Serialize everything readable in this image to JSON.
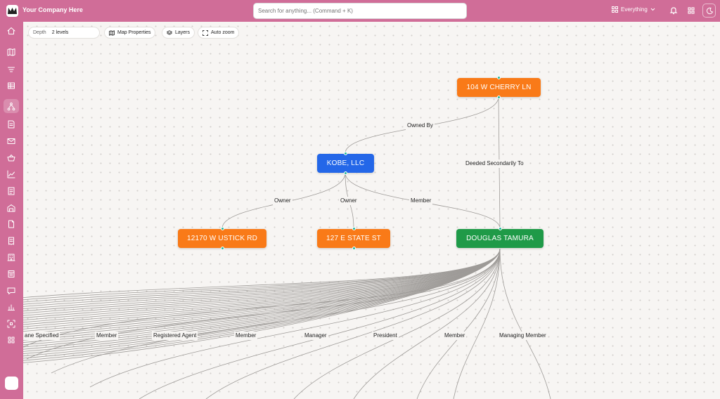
{
  "app": {
    "company_name": "Your Company Here",
    "search_placeholder": "Search for anything... (Command + K)",
    "scope_label": "Everything"
  },
  "toolbar": {
    "depth_label": "Depth",
    "depth_value": "2 levels",
    "map_properties_label": "Map Properties",
    "layers_label": "Layers",
    "auto_zoom_label": "Auto zoom"
  },
  "sidebar": {
    "items": [
      {
        "icon": "home-icon"
      },
      {
        "icon": "map-icon"
      },
      {
        "icon": "filter-icon"
      },
      {
        "icon": "table-icon"
      },
      {
        "icon": "graph-icon",
        "active": true
      },
      {
        "icon": "document-icon"
      },
      {
        "icon": "mail-icon"
      },
      {
        "icon": "basket-icon"
      },
      {
        "icon": "trend-chart-icon"
      },
      {
        "icon": "report-icon"
      },
      {
        "icon": "warehouse-icon"
      },
      {
        "icon": "file-icon"
      },
      {
        "icon": "receipt-icon"
      },
      {
        "icon": "building-icon"
      },
      {
        "icon": "ledger-icon"
      },
      {
        "icon": "chat-icon"
      },
      {
        "icon": "bar-chart-icon"
      },
      {
        "icon": "scan-icon"
      },
      {
        "icon": "apps-grid-icon"
      }
    ]
  },
  "graph": {
    "nodes": [
      {
        "label": "104 W CHERRY LN",
        "color": "#f97a18"
      },
      {
        "label": "KOBE, LLC",
        "color": "#2467e8"
      },
      {
        "label": "12170 W USTICK RD",
        "color": "#f97a18"
      },
      {
        "label": "127 E STATE ST",
        "color": "#f97a18"
      },
      {
        "label": "DOUGLAS TAMURA",
        "color": "#1f9a48"
      }
    ],
    "edge_labels": [
      "Owned By",
      "Deeded Secondarily To",
      "Owner",
      "Owner",
      "Member",
      "ane Specified",
      "Member",
      "Registered Agent",
      "Member",
      "Manager",
      "President",
      "Member",
      "Managing Member"
    ]
  },
  "colors": {
    "brand": "#d06d98",
    "canvas": "#f7f5f3",
    "port": "#23b79a",
    "edge": "#9e9b98"
  }
}
